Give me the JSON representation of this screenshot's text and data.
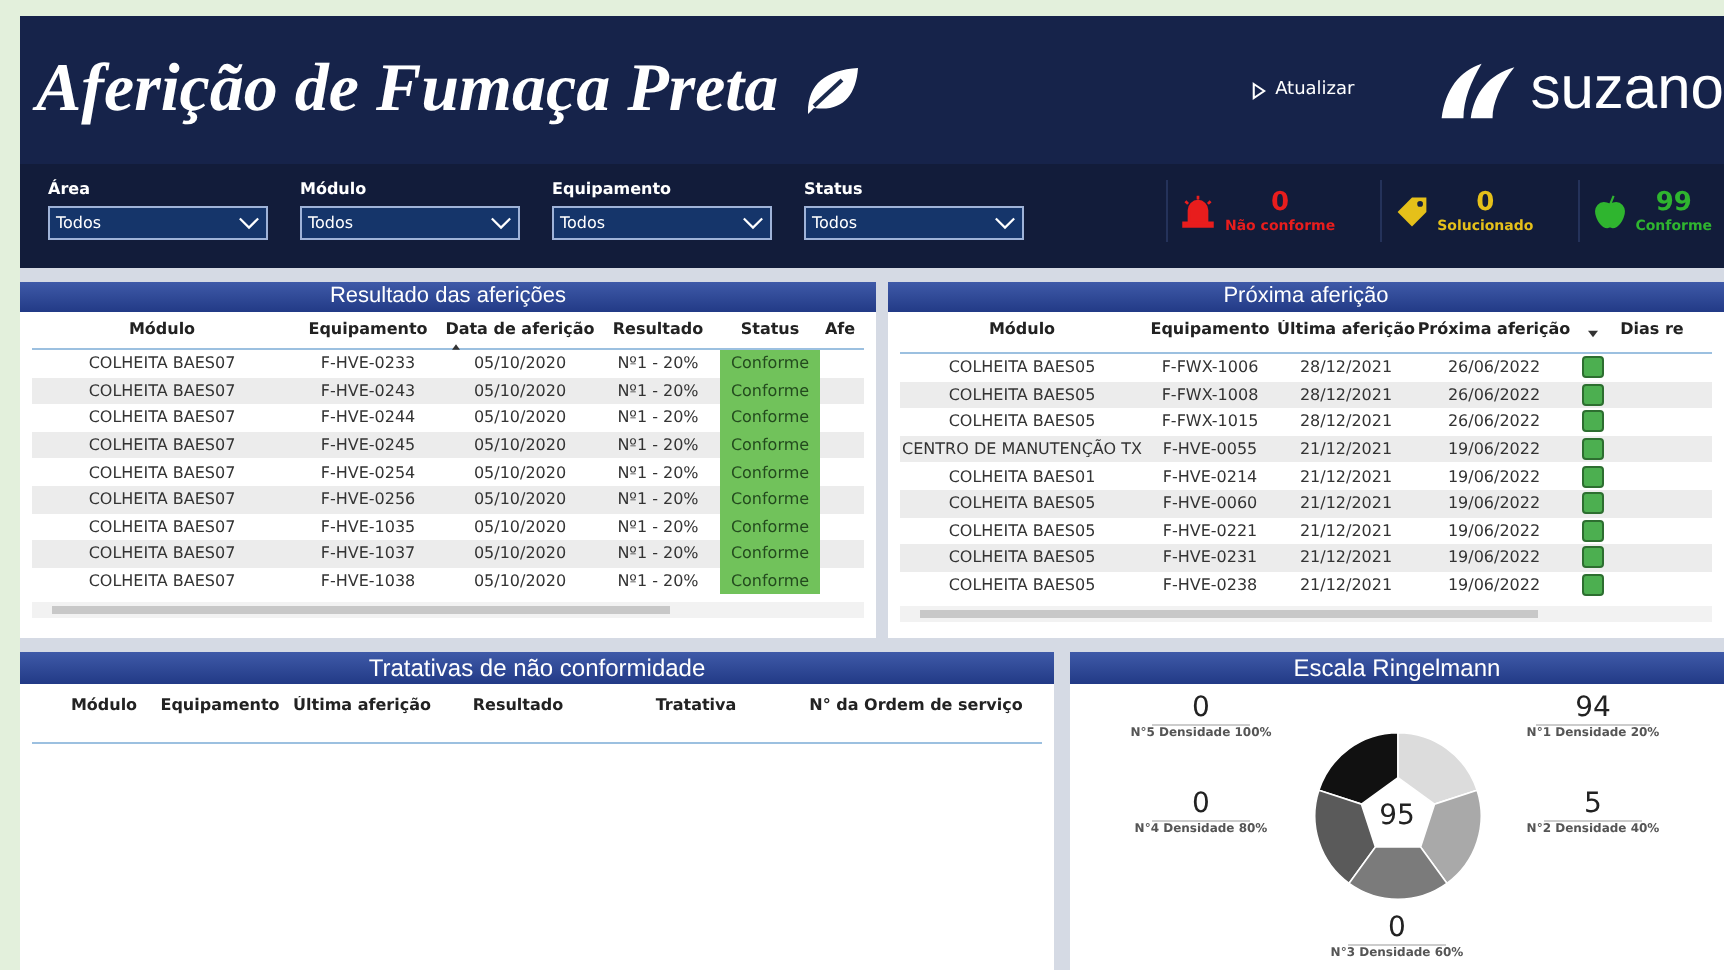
{
  "header": {
    "title": "Aferição de Fumaça Preta",
    "refresh": "Atualizar",
    "brand": "suzano"
  },
  "filters": [
    {
      "label": "Área",
      "value": "Todos"
    },
    {
      "label": "Módulo",
      "value": "Todos"
    },
    {
      "label": "Equipamento",
      "value": "Todos"
    },
    {
      "label": "Status",
      "value": "Todos"
    }
  ],
  "kpis": [
    {
      "kind": "alarm",
      "value": "0",
      "label": "Não conforme",
      "color": "#e81d1d"
    },
    {
      "kind": "tag",
      "value": "0",
      "label": "Solucionado",
      "color": "#e5c01a"
    },
    {
      "kind": "apple",
      "value": "99",
      "label": "Conforme",
      "color": "#2fb52f"
    }
  ],
  "results": {
    "title": "Resultado das aferições",
    "columns": [
      "Módulo",
      "Equipamento",
      "Data de aferição",
      "Resultado",
      "Status",
      "Afe"
    ],
    "rows": [
      [
        "COLHEITA BAES07",
        "F-HVE-0233",
        "05/10/2020",
        "Nº1 - 20%",
        "Conforme"
      ],
      [
        "COLHEITA BAES07",
        "F-HVE-0243",
        "05/10/2020",
        "Nº1 - 20%",
        "Conforme"
      ],
      [
        "COLHEITA BAES07",
        "F-HVE-0244",
        "05/10/2020",
        "Nº1 - 20%",
        "Conforme"
      ],
      [
        "COLHEITA BAES07",
        "F-HVE-0245",
        "05/10/2020",
        "Nº1 - 20%",
        "Conforme"
      ],
      [
        "COLHEITA BAES07",
        "F-HVE-0254",
        "05/10/2020",
        "Nº1 - 20%",
        "Conforme"
      ],
      [
        "COLHEITA BAES07",
        "F-HVE-0256",
        "05/10/2020",
        "Nº1 - 20%",
        "Conforme"
      ],
      [
        "COLHEITA BAES07",
        "F-HVE-1035",
        "05/10/2020",
        "Nº1 - 20%",
        "Conforme"
      ],
      [
        "COLHEITA BAES07",
        "F-HVE-1037",
        "05/10/2020",
        "Nº1 - 20%",
        "Conforme"
      ],
      [
        "COLHEITA BAES07",
        "F-HVE-1038",
        "05/10/2020",
        "Nº1 - 20%",
        "Conforme"
      ]
    ]
  },
  "next": {
    "title": "Próxima aferição",
    "columns": [
      "Módulo",
      "Equipamento",
      "Última aferição",
      "Próxima aferição",
      "",
      "Dias re"
    ],
    "rows": [
      [
        "COLHEITA BAES05",
        "F-FWX-1006",
        "28/12/2021",
        "26/06/2022"
      ],
      [
        "COLHEITA BAES05",
        "F-FWX-1008",
        "28/12/2021",
        "26/06/2022"
      ],
      [
        "COLHEITA BAES05",
        "F-FWX-1015",
        "28/12/2021",
        "26/06/2022"
      ],
      [
        "CENTRO DE MANUTENÇÃO TX",
        "F-HVE-0055",
        "21/12/2021",
        "19/06/2022"
      ],
      [
        "COLHEITA BAES01",
        "F-HVE-0214",
        "21/12/2021",
        "19/06/2022"
      ],
      [
        "COLHEITA BAES05",
        "F-HVE-0060",
        "21/12/2021",
        "19/06/2022"
      ],
      [
        "COLHEITA BAES05",
        "F-HVE-0221",
        "21/12/2021",
        "19/06/2022"
      ],
      [
        "COLHEITA BAES05",
        "F-HVE-0231",
        "21/12/2021",
        "19/06/2022"
      ],
      [
        "COLHEITA BAES05",
        "F-HVE-0238",
        "21/12/2021",
        "19/06/2022"
      ]
    ]
  },
  "treatments": {
    "title": "Tratativas de não conformidade",
    "columns": [
      "Módulo",
      "Equipamento",
      "Última aferição",
      "Resultado",
      "Tratativa",
      "N° da Ordem de serviço"
    ]
  },
  "ringelmann": {
    "title": "Escala Ringelmann",
    "total": "95",
    "levels": [
      {
        "value": "0",
        "label": "N°5 Densidade 100%",
        "color": "#111111"
      },
      {
        "value": "94",
        "label": "N°1 Densidade 20%",
        "color": "#dcdcdc"
      },
      {
        "value": "0",
        "label": "N°4 Densidade 80%",
        "color": "#5a5a5a"
      },
      {
        "value": "5",
        "label": "N°2 Densidade 40%",
        "color": "#a9a9a9"
      },
      {
        "value": "0",
        "label": "N°3 Densidade 60%",
        "color": "#7b7b7b"
      }
    ]
  }
}
